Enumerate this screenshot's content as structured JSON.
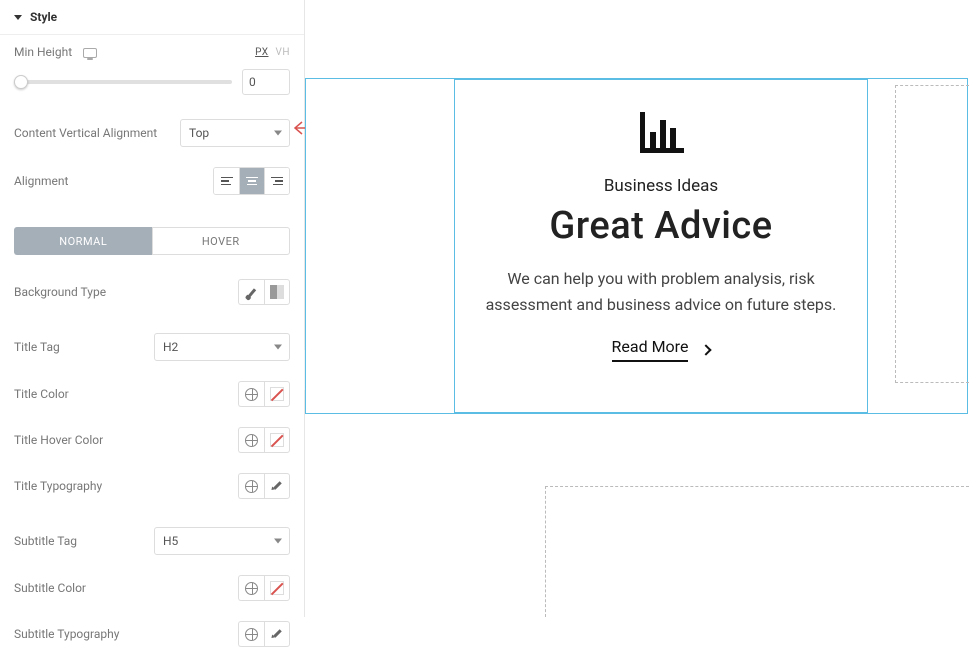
{
  "panel": {
    "section_title": "Style",
    "min_height_label": "Min Height",
    "units": {
      "px": "PX",
      "vh": "VH"
    },
    "min_height_value": "0",
    "cva_label": "Content Vertical Alignment",
    "cva_value": "Top",
    "alignment_label": "Alignment",
    "tabs": {
      "normal": "NORMAL",
      "hover": "HOVER"
    },
    "bg_type_label": "Background Type",
    "title_tag_label": "Title Tag",
    "title_tag_value": "H2",
    "title_color_label": "Title Color",
    "title_hover_color_label": "Title Hover Color",
    "title_typo_label": "Title Typography",
    "subtitle_tag_label": "Subtitle Tag",
    "subtitle_tag_value": "H5",
    "subtitle_color_label": "Subtitle Color",
    "subtitle_typo_label": "Subtitle Typography"
  },
  "card": {
    "subtitle": "Business Ideas",
    "title": "Great Advice",
    "desc": "We can help you with problem analysis, risk assessment and business advice on future steps.",
    "read_more": "Read More"
  }
}
